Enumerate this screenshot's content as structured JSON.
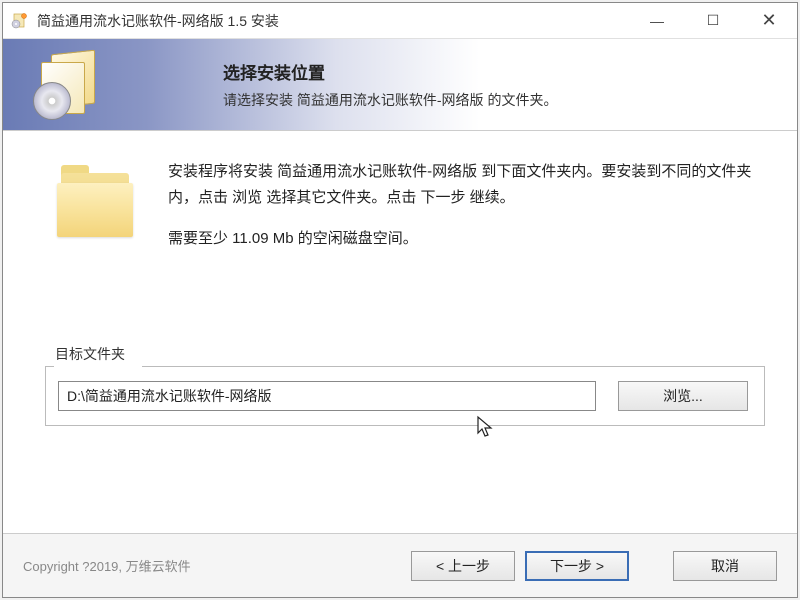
{
  "titlebar": {
    "text": "简益通用流水记账软件-网络版 1.5 安装"
  },
  "header": {
    "title": "选择安装位置",
    "subtitle": "请选择安装 简益通用流水记账软件-网络版 的文件夹。"
  },
  "content": {
    "description_line1": "安装程序将安装 简益通用流水记账软件-网络版 到下面文件夹内。要安装到不同的文件夹内，点击 浏览 选择其它文件夹。点击 下一步 继续。",
    "space_required": "需要至少 11.09 Mb 的空闲磁盘空间。"
  },
  "target": {
    "label": "目标文件夹",
    "path": "D:\\简益通用流水记账软件-网络版",
    "browse_label": "浏览..."
  },
  "footer": {
    "copyright": "Copyright ?2019, 万维云软件",
    "back_label": "< 上一步",
    "next_label": "下一步 >",
    "cancel_label": "取消"
  }
}
